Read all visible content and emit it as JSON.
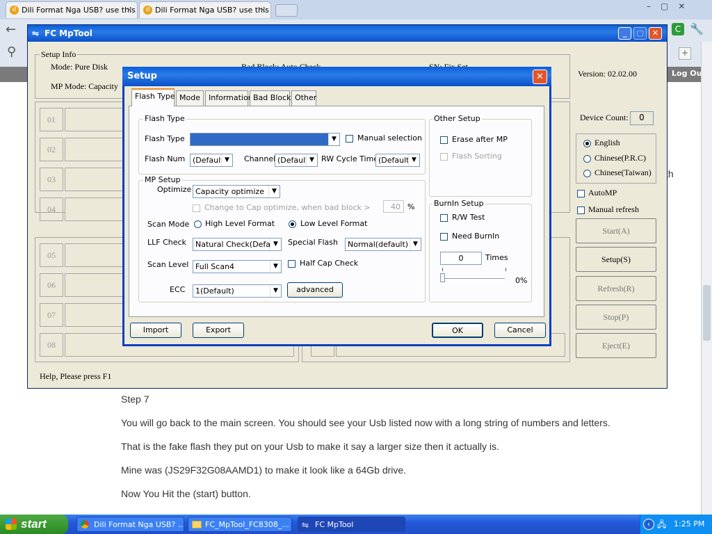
{
  "chrome": {
    "tabs": [
      {
        "label": "Dili Format Nga USB? use this"
      },
      {
        "label": "Dili Format Nga USB? use this"
      }
    ],
    "log_out": "Log Out"
  },
  "webpage": {
    "partial_text": "th",
    "lines": [
      "Step 7",
      "You will go back to the main screen. You should see your Usb listed now with a long string of numbers and letters.",
      "That is the fake flash they put on your Usb to make it say a larger size then it actually is.",
      "Mine was (JS29F32G08AAMD1) to make it look like a 64Gb drive.",
      "Now You Hit the (start) button."
    ]
  },
  "mptool": {
    "title": "FC MpTool",
    "setup_info": {
      "label": "Setup Info",
      "mode": "Mode: Pure Disk",
      "mp_mode": "MP Mode: Capacity",
      "bad_block": "Bad Block: Auto Check",
      "sn": "SN: Fix Set"
    },
    "version": "Version: 02.02.00",
    "device_count_label": "Device Count:",
    "device_count": "0",
    "ports": [
      "01",
      "02",
      "03",
      "04",
      "05",
      "06",
      "07",
      "08"
    ],
    "languages": [
      "English",
      "Chinese(P.R.C)",
      "Chinese(Taiwan)"
    ],
    "selected_language": "English",
    "automp": "AutoMP",
    "manual_refresh": "Manual refresh",
    "buttons": {
      "start": "Start(A)",
      "setup": "Setup(S)",
      "refresh": "Refresh(R)",
      "stop": "Stop(P)",
      "eject": "Eject(E)"
    },
    "help": "Help, Please press F1"
  },
  "setup": {
    "title": "Setup",
    "tabs": [
      "Flash Type",
      "Mode",
      "Information",
      "Bad Block",
      "Other"
    ],
    "active_tab": "Flash Type",
    "flash_type_group": {
      "label": "Flash Type",
      "flash_type_label": "Flash Type",
      "flash_type_value": "",
      "manual_selection": "Manual selection",
      "flash_num_label": "Flash Num",
      "flash_num_value": "(Default)",
      "channel_label": "Channel",
      "channel_value": "(Default)",
      "rw_cycle_label": "RW Cycle Time",
      "rw_cycle_value": "(Default)"
    },
    "other_setup": {
      "label": "Other Setup",
      "erase_after_mp": "Erase after MP",
      "flash_sorting": "Flash Sorting"
    },
    "mp_setup": {
      "label": "MP Setup",
      "optimize_label": "Optimize",
      "optimize_value": "Capacity optimize",
      "change_to_cap": "Change to Cap optimize, when bad block >",
      "change_threshold": "40",
      "percent": "%",
      "scan_mode_label": "Scan Mode",
      "high_level": "High Level Format",
      "low_level": "Low Level Format",
      "llf_check_label": "LLF Check",
      "llf_check_value": "Natural Check(Default)",
      "special_flash_label": "Special Flash",
      "special_flash_value": "Normal(default)",
      "scan_level_label": "Scan Level",
      "scan_level_value": "Full Scan4",
      "half_cap_check": "Half Cap Check",
      "ecc_label": "ECC",
      "ecc_value": "1(Default)",
      "advanced": "advanced"
    },
    "burnin": {
      "label": "BurnIn Setup",
      "rw_test": "R/W Test",
      "need_burnin": "Need BurnIn",
      "times_value": "0",
      "times_label": "Times",
      "progress_percent": "0%",
      "progress": 0
    },
    "buttons": {
      "import": "Import",
      "export": "Export",
      "ok": "OK",
      "cancel": "Cancel"
    }
  },
  "taskbar": {
    "start": "start",
    "tasks": [
      "Dili Format Nga USB? ...",
      "FC_MpTool_FC8308_...",
      "FC MpTool"
    ],
    "time": "1:25 PM"
  }
}
